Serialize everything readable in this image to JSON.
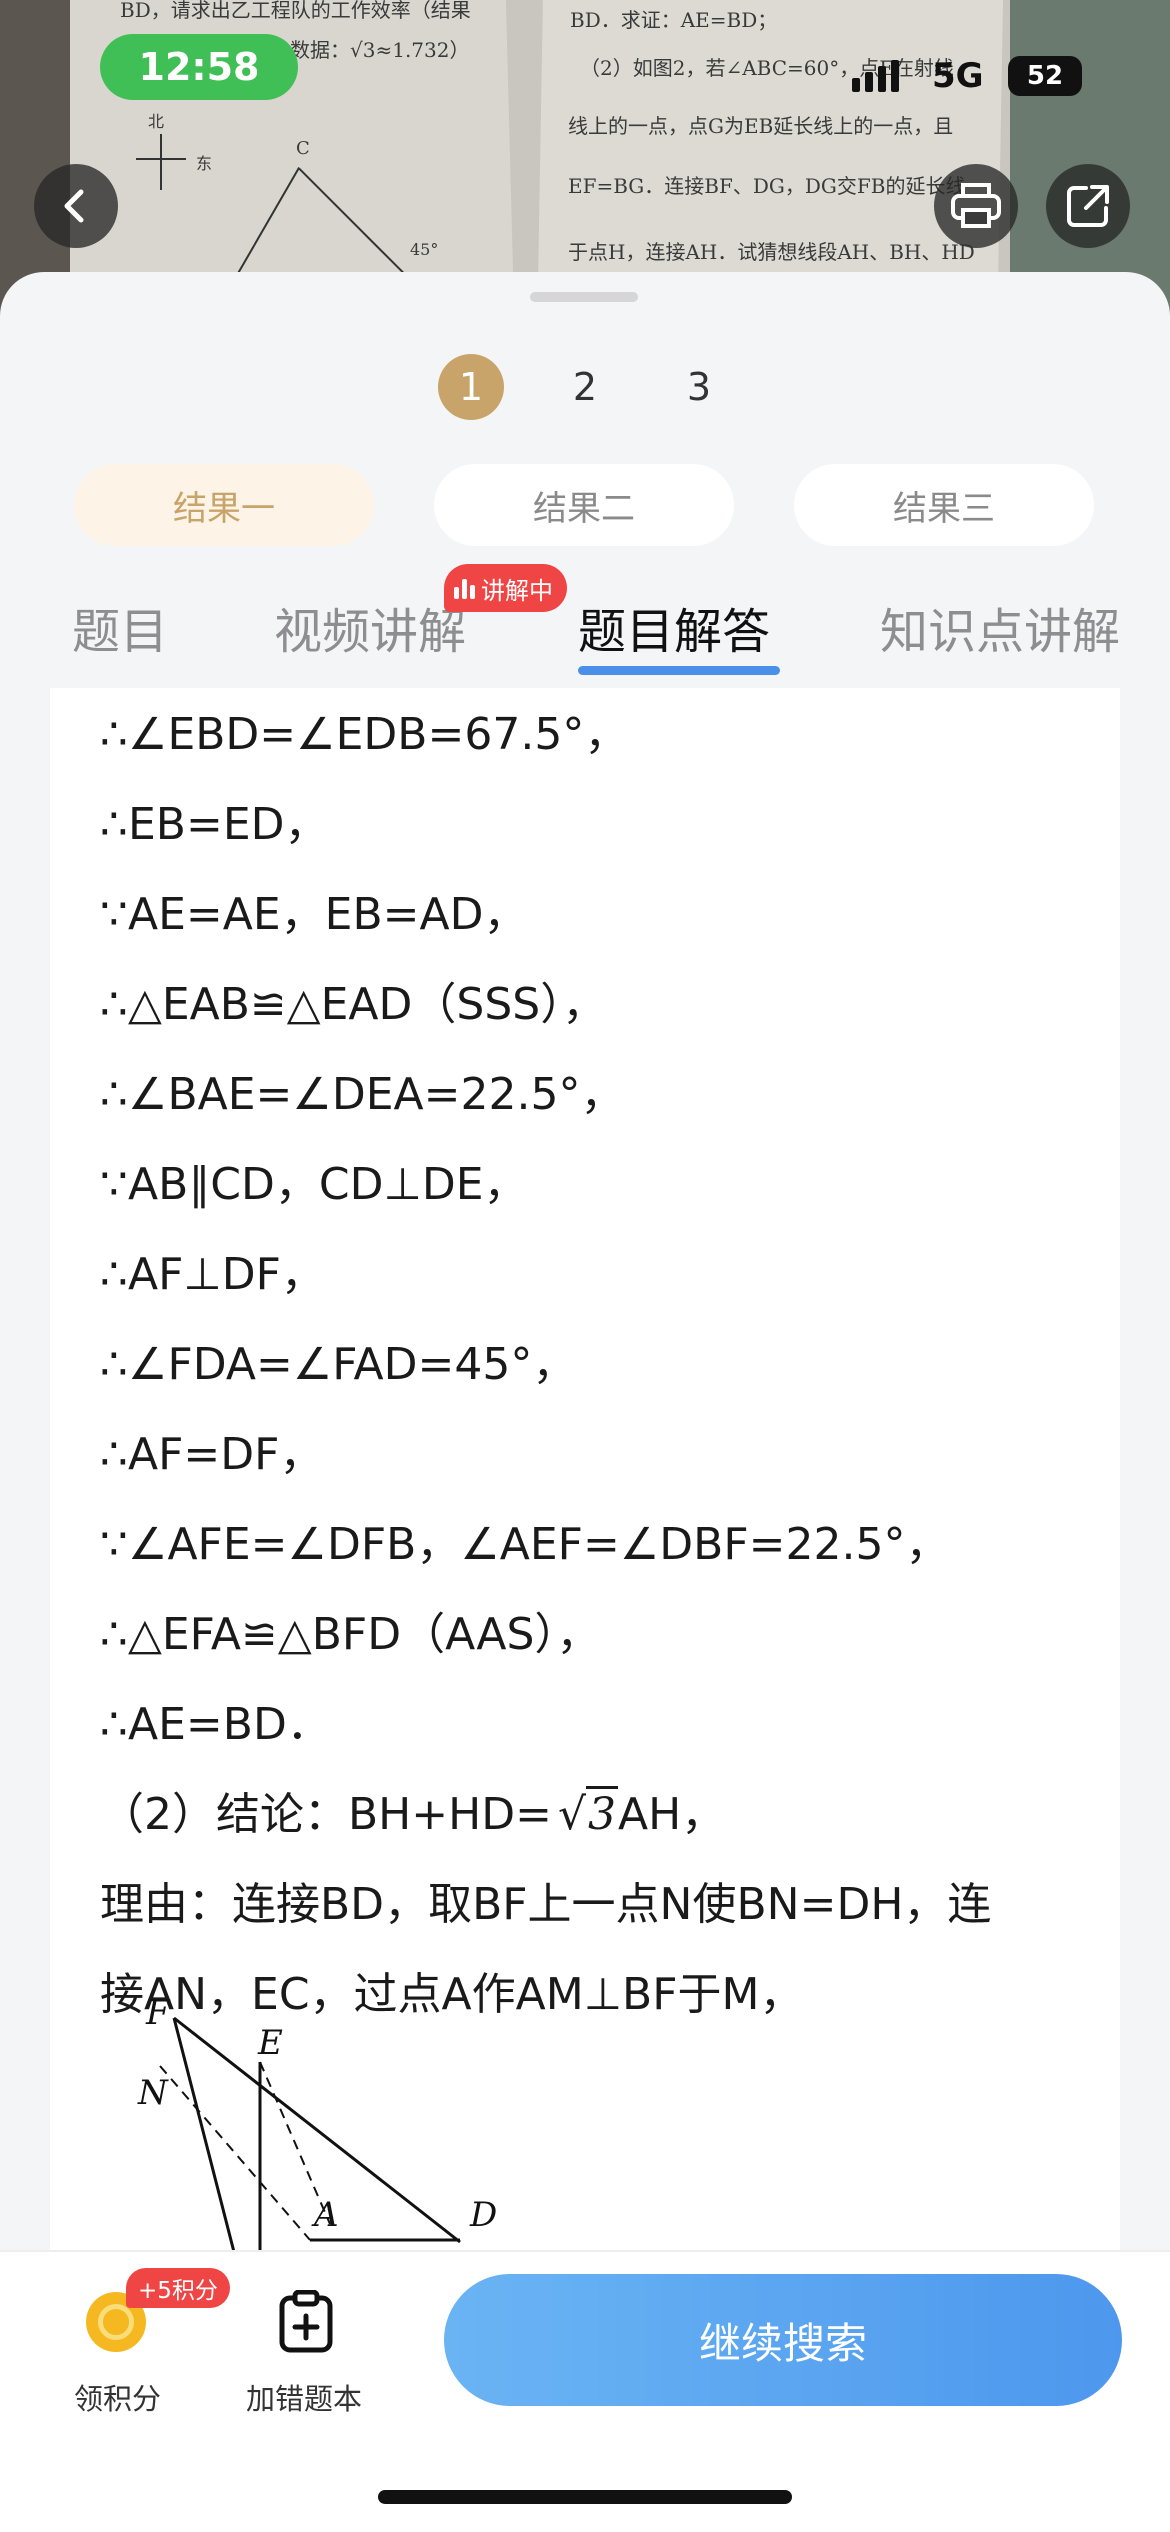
{
  "status_bar": {
    "time": "12:58",
    "network": "5G",
    "battery": "52"
  },
  "photo": {
    "left_lines": [
      "BD，请求出乙工程队的工作效率（结果",
      "精确数据：√3≈1.732）"
    ],
    "right_lines": [
      "BD．求证：AE=BD；",
      "（2）如图2，若∠ABC=60°，点E在射线",
      "线上的一点，点G为EB延长线上的一点，且",
      "EF=BG．连接BF、DG，DG交FB的延长线",
      "于点H，连接AH．试猜想线段AH、BH、HD"
    ],
    "compass": "北",
    "compass_e": "东",
    "point_c": "C",
    "angle": "45°"
  },
  "pager": {
    "pages": [
      "1",
      "2",
      "3"
    ],
    "active_page": "1"
  },
  "result_tabs": [
    "结果一",
    "结果二",
    "结果三"
  ],
  "section_tabs": [
    "题目",
    "视频讲解",
    "题目解答",
    "知识点讲解"
  ],
  "live_badge": "讲解中",
  "solution": {
    "lines": [
      "∴∠EBD=∠EDB=67.5°，",
      "∴EB=ED，",
      "∵AE=AE，EB=AD，",
      "∴△EAB≌△EAD（SSS），",
      "∴∠BAE=∠DEA=22.5°，",
      "∵AB∥CD，CD⊥DE，",
      "∴AF⊥DF，",
      "∴∠FDA=∠FAD=45°，",
      "∴AF=DF，",
      "∵∠AFE=∠DFB，∠AEF=∠DBF=22.5°，",
      "∴△EFA≌△BFD（AAS），",
      "∴AE=BD．"
    ],
    "conclusion_prefix": "（2）结论：BH+HD=",
    "conclusion_root": "3",
    "conclusion_suffix": "AH，",
    "reason_line1": "理由：连接BD，取BF上一点N使BN=DH，连",
    "reason_line2": "接AN，EC，过点A作AM⊥BF于M，",
    "figure_labels": {
      "F": "F",
      "E": "E",
      "N": "N",
      "A": "A",
      "D": "D"
    }
  },
  "bottom_bar": {
    "points_badge": "+5积分",
    "claim_points": "领积分",
    "add_mistake": "加错题本",
    "continue_search": "继续搜索"
  }
}
